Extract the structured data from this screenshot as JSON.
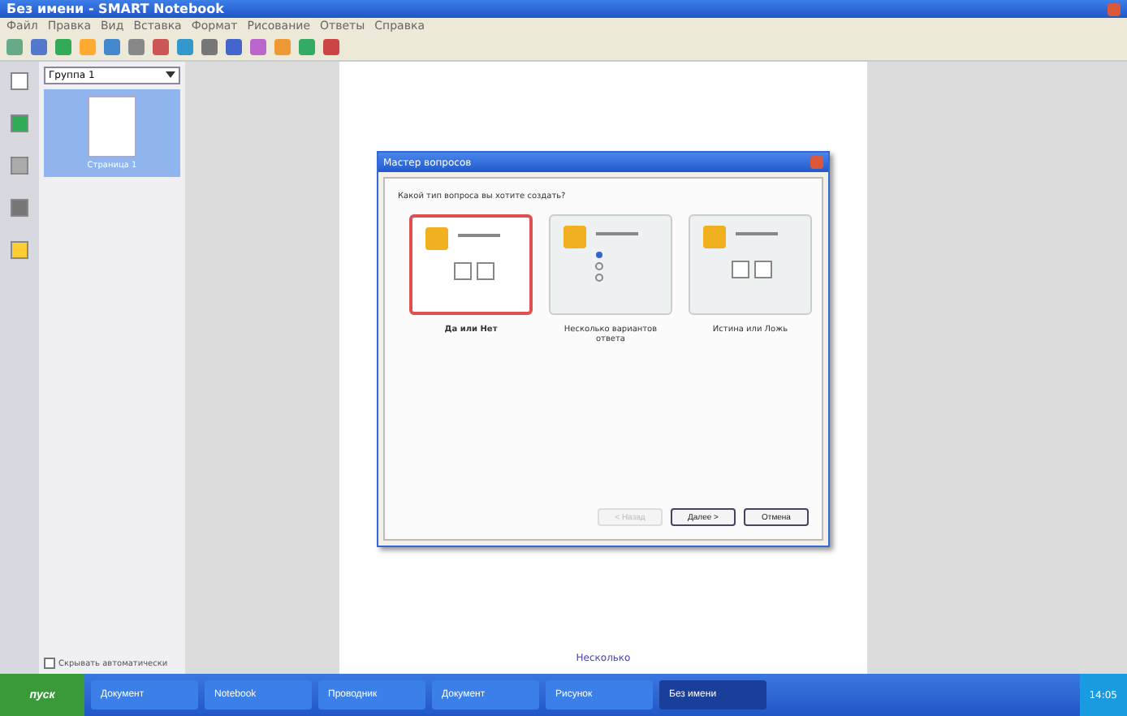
{
  "window": {
    "title": "Без имени - SMART Notebook"
  },
  "menu": [
    "Файл",
    "Правка",
    "Вид",
    "Вставка",
    "Формат",
    "Рисование",
    "Ответы",
    "Справка"
  ],
  "sidebar": {
    "group": "Группа 1",
    "pages": [
      {
        "label": "Страница 1",
        "selected": true
      }
    ],
    "auto_hide": {
      "label": "Скрывать автоматически",
      "checked": false
    }
  },
  "dialog": {
    "title": "Мастер вопросов",
    "prompt": "Какой тип вопроса вы хотите создать?",
    "options": [
      {
        "label": "Да или Нет",
        "kind": "yesno",
        "selected": true
      },
      {
        "label": "Несколько вариантов ответа",
        "kind": "multiple",
        "selected": false
      },
      {
        "label": "Истина или Ложь",
        "kind": "truefalse",
        "selected": false
      }
    ],
    "buttons": [
      {
        "label": "< Назад",
        "disabled": true
      },
      {
        "label": "Далее >",
        "disabled": false
      },
      {
        "label": "Отмена",
        "disabled": false
      }
    ]
  },
  "page_link": "Несколько",
  "taskbar": {
    "start": "пуск",
    "tasks": [
      {
        "label": "Документ",
        "selected": false
      },
      {
        "label": "Notebook",
        "selected": false
      },
      {
        "label": "Проводник",
        "selected": false
      },
      {
        "label": "Документ",
        "selected": false
      },
      {
        "label": "Рисунок",
        "selected": false
      },
      {
        "label": "Без имени",
        "selected": true
      }
    ],
    "clock": "14:05"
  }
}
